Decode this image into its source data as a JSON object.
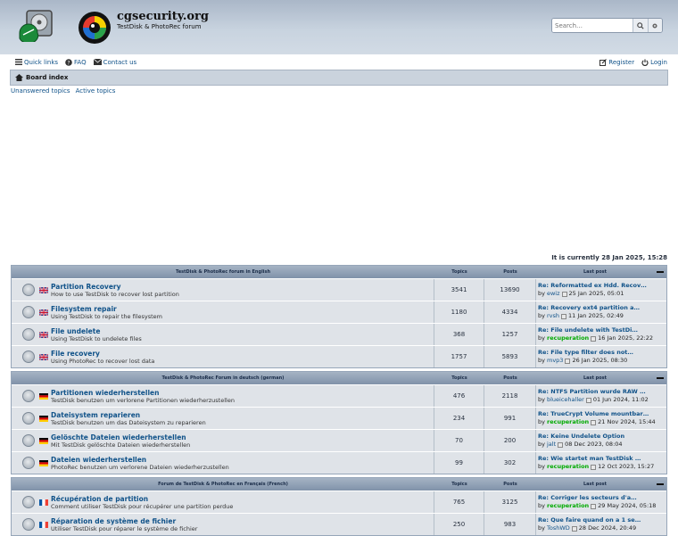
{
  "header": {
    "site_title": "cgsecurity.org",
    "site_description": "TestDisk & PhotoRec forum",
    "search_placeholder": "Search…",
    "logo_icons": [
      "hard-drive-icon",
      "colorful-eye-icon"
    ]
  },
  "nav": {
    "quick_links": "Quick links",
    "faq": "FAQ",
    "contact": "Contact us",
    "register": "Register",
    "login": "Login"
  },
  "breadcrumb": {
    "label": "Board index"
  },
  "sublinks": {
    "unanswered": "Unanswered topics",
    "active": "Active topics"
  },
  "time": "It is currently 28 Jan 2025, 15:28",
  "blocks": [
    {
      "title": "TestDisk & PhotoRec forum in English",
      "col_topics": "Topics",
      "col_posts": "Posts",
      "col_last": "Last post",
      "flag": "uk",
      "forums": [
        {
          "name": "Partition Recovery",
          "desc": "How to use TestDisk to recover lost partition",
          "topics": "3541",
          "posts": "13690",
          "last_title": "Re: Reformatted ex Hdd. Recov…",
          "by": "by",
          "author": "ewiz",
          "author_mod": false,
          "date": "25 Jan 2025, 05:01"
        },
        {
          "name": "Filesystem repair",
          "desc": "Using TestDisk to repair the filesystem",
          "topics": "1180",
          "posts": "4334",
          "last_title": "Re: Recovery ext4 partition a…",
          "by": "by",
          "author": "rvsh",
          "author_mod": false,
          "date": "11 Jan 2025, 02:49"
        },
        {
          "name": "File undelete",
          "desc": "Using TestDisk to undelete files",
          "topics": "368",
          "posts": "1257",
          "last_title": "Re: File undelete with TestDi…",
          "by": "by",
          "author": "recuperation",
          "author_mod": true,
          "date": "16 Jan 2025, 22:22"
        },
        {
          "name": "File recovery",
          "desc": "Using PhotoRec to recover lost data",
          "topics": "1757",
          "posts": "5893",
          "last_title": "Re: File type filter does not…",
          "by": "by",
          "author": "mvp3",
          "author_mod": false,
          "date": "26 Jan 2025, 08:30"
        }
      ]
    },
    {
      "title": "TestDisk & PhotoRec Forum in deutsch (german)",
      "col_topics": "Topics",
      "col_posts": "Posts",
      "col_last": "Last post",
      "flag": "de",
      "forums": [
        {
          "name": "Partitionen wiederherstellen",
          "desc": "TestDisk benutzen um verlorene Partitionen wiederherzustellen",
          "topics": "476",
          "posts": "2118",
          "last_title": "Re: NTFS Partition wurde RAW …",
          "by": "by",
          "author": "blueicehaller",
          "author_mod": false,
          "date": "01 Jun 2024, 11:02"
        },
        {
          "name": "Dateisystem reparieren",
          "desc": "TestDisk benutzen um das Dateisystem zu reparieren",
          "topics": "234",
          "posts": "991",
          "last_title": "Re: TrueCrypt Volume mountbar…",
          "by": "by",
          "author": "recuperation",
          "author_mod": true,
          "date": "21 Nov 2024, 15:44"
        },
        {
          "name": "Gelöschte Dateien wiederherstellen",
          "desc": "Mit TestDisk gelöschte Dateien wiederherstellen",
          "topics": "70",
          "posts": "200",
          "last_title": "Re: Keine Undelete Option",
          "by": "by",
          "author": "jalt",
          "author_mod": false,
          "date": "08 Dec 2023, 08:04"
        },
        {
          "name": "Dateien wiederherstellen",
          "desc": "PhotoRec benutzen um verlorene Dateien wiederherzustellen",
          "topics": "99",
          "posts": "302",
          "last_title": "Re: Wie startet man TestDisk …",
          "by": "by",
          "author": "recuperation",
          "author_mod": true,
          "date": "12 Oct 2023, 15:27"
        }
      ]
    },
    {
      "title": "Forum de TestDisk & PhotoRec en Français (French)",
      "col_topics": "Topics",
      "col_posts": "Posts",
      "col_last": "Last post",
      "flag": "fr",
      "forums": [
        {
          "name": "Récupération de partition",
          "desc": "Comment utiliser TestDisk pour récupérer une partition perdue",
          "topics": "765",
          "posts": "3125",
          "last_title": "Re: Corriger les secteurs d'a…",
          "by": "by",
          "author": "recuperation",
          "author_mod": true,
          "date": "29 May 2024, 05:18"
        },
        {
          "name": "Réparation de système de fichier",
          "desc": "Utiliser TestDisk pour réparer le système de fichier",
          "topics": "250",
          "posts": "983",
          "last_title": "Re: Que faire quand on a 1 se…",
          "by": "by",
          "author": "ToshWD",
          "author_mod": false,
          "date": "28 Dec 2024, 20:49"
        }
      ]
    }
  ],
  "colors": {
    "link": "#105289",
    "header_bg": "#aab7c8",
    "row_bg": "#dfe3e8",
    "moderator": "#00aa00"
  }
}
